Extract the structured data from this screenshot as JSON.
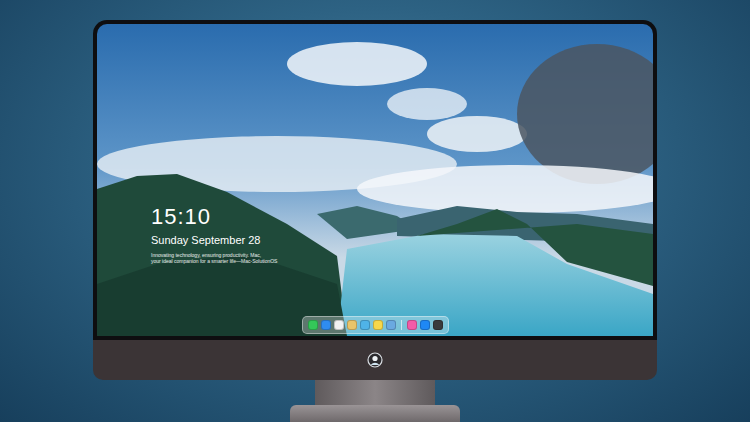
{
  "lock_screen": {
    "time": "15:10",
    "date": "Sunday September 28",
    "tagline": [
      "Innovating technology, ensuring productivity. Mac,",
      "your ideal companion for a smarter life—Mac-SolutionOS"
    ]
  },
  "dock": {
    "groups": [
      [
        {
          "color": "#34c759"
        },
        {
          "color": "#2f8cf0"
        },
        {
          "color": "#f2f2f2"
        },
        {
          "color": "#e9c46a"
        },
        {
          "color": "#4fb3e8"
        },
        {
          "color": "#f7d74a"
        },
        {
          "color": "#6aa9e0"
        }
      ],
      [
        {
          "color": "#f25ca8"
        },
        {
          "color": "#1e88f5"
        },
        {
          "color": "#3a3a3c"
        }
      ]
    ]
  }
}
